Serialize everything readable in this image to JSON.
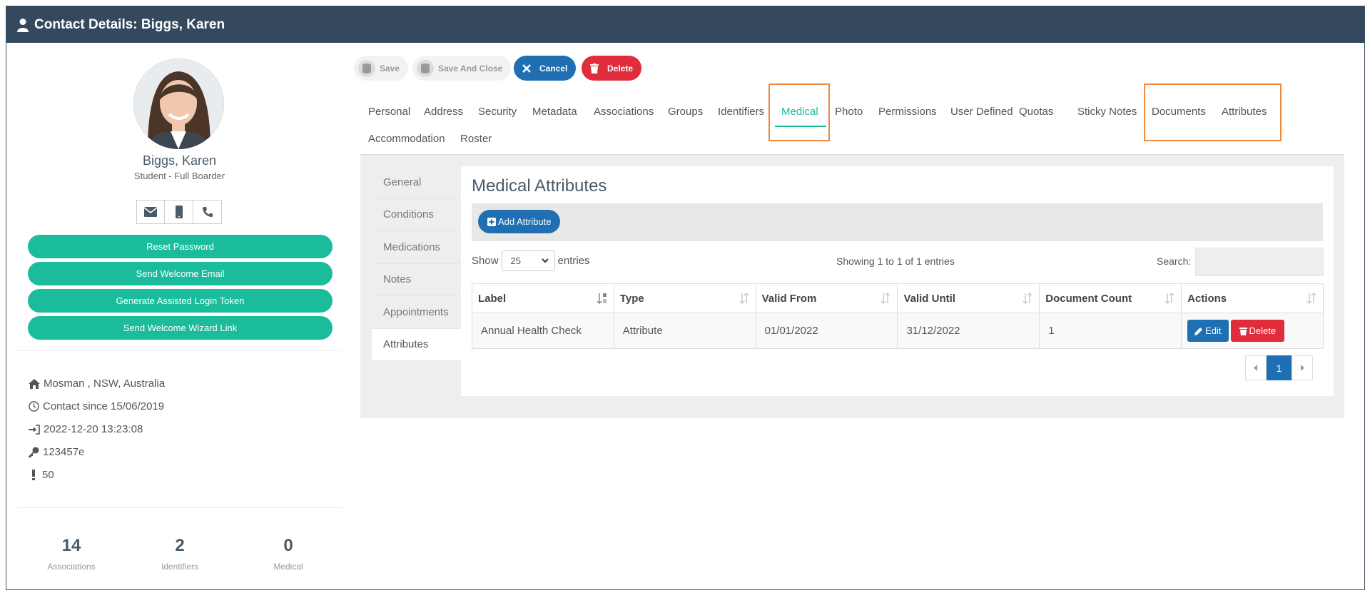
{
  "window": {
    "title": "Contact Details: Biggs, Karen"
  },
  "profile": {
    "name": "Biggs, Karen",
    "role": "Student - Full Boarder",
    "contact_icons": [
      "envelope-icon",
      "mobile-icon",
      "phone-icon"
    ],
    "actions": [
      "Reset Password",
      "Send Welcome Email",
      "Generate Assisted Login Token",
      "Send Welcome Wizard Link"
    ],
    "info": {
      "location": "Mosman , NSW, Australia",
      "contact_since": "Contact since 15/06/2019",
      "last_login": "2022-12-20 13:23:08",
      "key": "123457e",
      "alerts": "50"
    },
    "stats": [
      {
        "value": "14",
        "label": "Associations"
      },
      {
        "value": "2",
        "label": "Identifiers"
      },
      {
        "value": "0",
        "label": "Medical"
      }
    ]
  },
  "toolbar": {
    "save": "Save",
    "save_close": "Save And Close",
    "cancel": "Cancel",
    "delete": "Delete"
  },
  "tabs": [
    "Personal",
    "Address",
    "Security",
    "Metadata",
    "Associations",
    "Groups",
    "Identifiers",
    "Medical",
    "Photo",
    "Permissions",
    "User Defined",
    "Quotas",
    "Sticky Notes",
    "Documents",
    "Attributes",
    "Accommodation",
    "Roster"
  ],
  "active_tab": "Medical",
  "subnav": [
    "General",
    "Conditions",
    "Medications",
    "Notes",
    "Appointments",
    "Attributes"
  ],
  "active_subnav": "Attributes",
  "section": {
    "title": "Medical Attributes",
    "add_label": "Add Attribute",
    "show_label": "Show",
    "page_size": "25",
    "entries_label": "entries",
    "showing": "Showing 1 to 1 of 1 entries",
    "search_label": "Search:"
  },
  "table": {
    "columns": [
      "Label",
      "Type",
      "Valid From",
      "Valid Until",
      "Document Count",
      "Actions"
    ],
    "rows": [
      [
        "Annual Health Check",
        "Attribute",
        "01/01/2022",
        "31/12/2022",
        "1"
      ]
    ],
    "edit_label": "Edit",
    "delete_label": "Delete"
  },
  "pagination": {
    "current": "1"
  },
  "colors": {
    "header": "#34495e",
    "accent": "#1abc9c",
    "primary": "#1f6fb2",
    "danger": "#e02d3c",
    "highlight": "#f0883e"
  }
}
